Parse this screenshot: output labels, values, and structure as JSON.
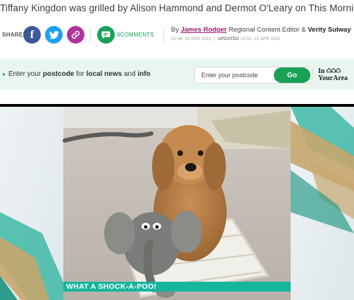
{
  "article": {
    "subtitle": "Tiffany Kingdon was grilled by Alison Hammond and Dermot O'Leary on This Morning"
  },
  "share": {
    "label": "SHARE",
    "comments_count": "9",
    "comments_label": "COMMENTS"
  },
  "byline": {
    "by": "By",
    "author": "James Rodger",
    "role": "Regional Content Editor &",
    "coauthor": "Verity Sulway",
    "published": "12:49, 15 APR 2021",
    "updated_label": "UPDATED",
    "updated": "13:02, 15 APR 2021"
  },
  "postcode": {
    "arrow": "▸",
    "text_prefix": "Enter your",
    "text_postcode": "postcode",
    "text_for": "for",
    "text_local": "local news",
    "text_and": "and",
    "text_info": "info",
    "placeholder": "Enter your postcode",
    "go_label": "Go",
    "brand_line1": "In",
    "brand_line2": "YourArea"
  },
  "media": {
    "caption_banner": "WHAT A SHOCK-A-POO!"
  },
  "colors": {
    "facebook": "#3b5998",
    "twitter": "#1da1f2",
    "link": "#b0359b",
    "comments_green": "#1aa057",
    "author_purple": "#9b1b6f",
    "banner_teal": "#17b59d"
  },
  "icons": [
    "facebook-icon",
    "twitter-icon",
    "link-icon",
    "comment-icon",
    "home-icon"
  ]
}
